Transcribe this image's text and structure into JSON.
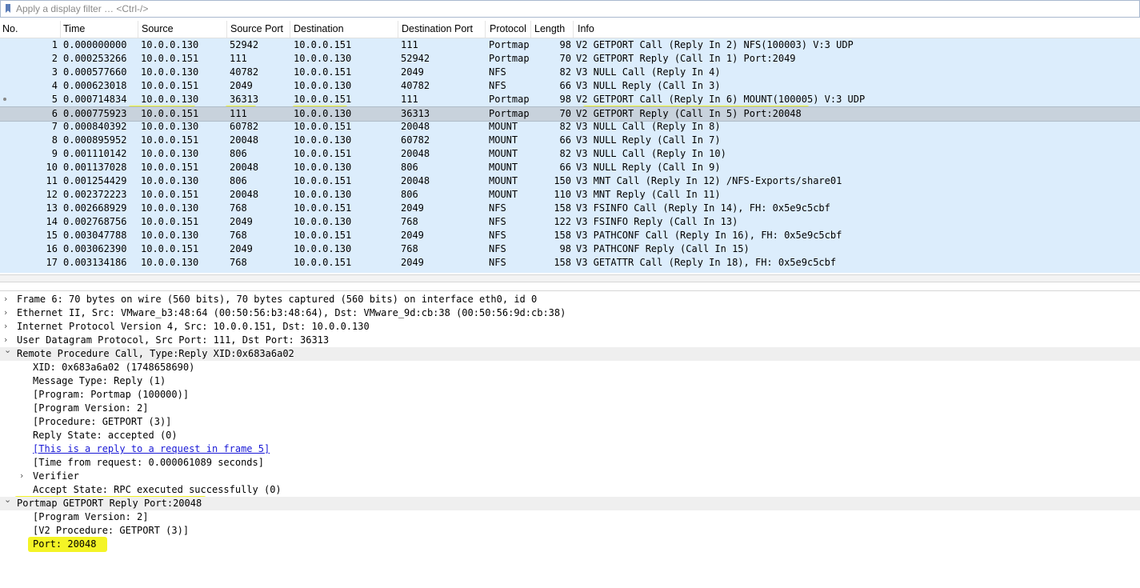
{
  "filter": {
    "placeholder": "Apply a display filter … <Ctrl-/>"
  },
  "columns": [
    "No.",
    "Time",
    "Source",
    "Source Port",
    "Destination",
    "Destination Port",
    "Protocol",
    "Length",
    "Info"
  ],
  "packets": [
    {
      "no": "1",
      "time": "0.000000000",
      "src": "10.0.0.130",
      "sport": "52942",
      "dst": "10.0.0.151",
      "dport": "111",
      "proto": "Portmap",
      "len": "98",
      "info": "V2 GETPORT Call (Reply In 2) NFS(100003) V:3 UDP"
    },
    {
      "no": "2",
      "time": "0.000253266",
      "src": "10.0.0.151",
      "sport": "111",
      "dst": "10.0.0.130",
      "dport": "52942",
      "proto": "Portmap",
      "len": "70",
      "info": "V2 GETPORT Reply (Call In 1) Port:2049"
    },
    {
      "no": "3",
      "time": "0.000577660",
      "src": "10.0.0.130",
      "sport": "40782",
      "dst": "10.0.0.151",
      "dport": "2049",
      "proto": "NFS",
      "len": "82",
      "info": "V3 NULL Call (Reply In 4)"
    },
    {
      "no": "4",
      "time": "0.000623018",
      "src": "10.0.0.151",
      "sport": "2049",
      "dst": "10.0.0.130",
      "dport": "40782",
      "proto": "NFS",
      "len": "66",
      "info": "V3 NULL Reply (Call In 3)"
    },
    {
      "no": "5",
      "time": "0.000714834",
      "src": "10.0.0.130",
      "sport": "36313",
      "dst": "10.0.0.151",
      "dport": "111",
      "proto": "Portmap",
      "len": "98",
      "info": "V2 GETPORT Call (Reply In 6) MOUNT(100005) V:3 UDP"
    },
    {
      "no": "6",
      "time": "0.000775923",
      "src": "10.0.0.151",
      "sport": "111",
      "dst": "10.0.0.130",
      "dport": "36313",
      "proto": "Portmap",
      "len": "70",
      "info": "V2 GETPORT Reply (Call In 5) Port:20048"
    },
    {
      "no": "7",
      "time": "0.000840392",
      "src": "10.0.0.130",
      "sport": "60782",
      "dst": "10.0.0.151",
      "dport": "20048",
      "proto": "MOUNT",
      "len": "82",
      "info": "V3 NULL Call (Reply In 8)"
    },
    {
      "no": "8",
      "time": "0.000895952",
      "src": "10.0.0.151",
      "sport": "20048",
      "dst": "10.0.0.130",
      "dport": "60782",
      "proto": "MOUNT",
      "len": "66",
      "info": "V3 NULL Reply (Call In 7)"
    },
    {
      "no": "9",
      "time": "0.001110142",
      "src": "10.0.0.130",
      "sport": "806",
      "dst": "10.0.0.151",
      "dport": "20048",
      "proto": "MOUNT",
      "len": "82",
      "info": "V3 NULL Call (Reply In 10)"
    },
    {
      "no": "10",
      "time": "0.001137028",
      "src": "10.0.0.151",
      "sport": "20048",
      "dst": "10.0.0.130",
      "dport": "806",
      "proto": "MOUNT",
      "len": "66",
      "info": "V3 NULL Reply (Call In 9)"
    },
    {
      "no": "11",
      "time": "0.001254429",
      "src": "10.0.0.130",
      "sport": "806",
      "dst": "10.0.0.151",
      "dport": "20048",
      "proto": "MOUNT",
      "len": "150",
      "info": "V3 MNT Call (Reply In 12) /NFS-Exports/share01"
    },
    {
      "no": "12",
      "time": "0.002372223",
      "src": "10.0.0.151",
      "sport": "20048",
      "dst": "10.0.0.130",
      "dport": "806",
      "proto": "MOUNT",
      "len": "110",
      "info": "V3 MNT Reply (Call In 11)"
    },
    {
      "no": "13",
      "time": "0.002668929",
      "src": "10.0.0.130",
      "sport": "768",
      "dst": "10.0.0.151",
      "dport": "2049",
      "proto": "NFS",
      "len": "158",
      "info": "V3 FSINFO Call (Reply In 14), FH: 0x5e9c5cbf"
    },
    {
      "no": "14",
      "time": "0.002768756",
      "src": "10.0.0.151",
      "sport": "2049",
      "dst": "10.0.0.130",
      "dport": "768",
      "proto": "NFS",
      "len": "122",
      "info": "V3 FSINFO Reply (Call In 13)"
    },
    {
      "no": "15",
      "time": "0.003047788",
      "src": "10.0.0.130",
      "sport": "768",
      "dst": "10.0.0.151",
      "dport": "2049",
      "proto": "NFS",
      "len": "158",
      "info": "V3 PATHCONF Call (Reply In 16), FH: 0x5e9c5cbf"
    },
    {
      "no": "16",
      "time": "0.003062390",
      "src": "10.0.0.151",
      "sport": "2049",
      "dst": "10.0.0.130",
      "dport": "768",
      "proto": "NFS",
      "len": "98",
      "info": "V3 PATHCONF Reply (Call In 15)"
    },
    {
      "no": "17",
      "time": "0.003134186",
      "src": "10.0.0.130",
      "sport": "768",
      "dst": "10.0.0.151",
      "dport": "2049",
      "proto": "NFS",
      "len": "158",
      "info": "V3 GETATTR Call (Reply In 18), FH: 0x5e9c5cbf"
    }
  ],
  "details": [
    {
      "text": "Frame 6: 70 bytes on wire (560 bits), 70 bytes captured (560 bits) on interface eth0, id 0",
      "indent": 0,
      "expander": "collapsed"
    },
    {
      "text": "Ethernet II, Src: VMware_b3:48:64 (00:50:56:b3:48:64), Dst: VMware_9d:cb:38 (00:50:56:9d:cb:38)",
      "indent": 0,
      "expander": "collapsed"
    },
    {
      "text": "Internet Protocol Version 4, Src: 10.0.0.151, Dst: 10.0.0.130",
      "indent": 0,
      "expander": "collapsed"
    },
    {
      "text": "User Datagram Protocol, Src Port: 111, Dst Port: 36313",
      "indent": 0,
      "expander": "collapsed"
    },
    {
      "text": "Remote Procedure Call, Type:Reply XID:0x683a6a02",
      "indent": 0,
      "expander": "expanded",
      "header": true
    },
    {
      "text": "XID: 0x683a6a02 (1748658690)",
      "indent": 1
    },
    {
      "text": "Message Type: Reply (1)",
      "indent": 1
    },
    {
      "text": "[Program: Portmap (100000)]",
      "indent": 1
    },
    {
      "text": "[Program Version: 2]",
      "indent": 1
    },
    {
      "text": "[Procedure: GETPORT (3)]",
      "indent": 1
    },
    {
      "text": "Reply State: accepted (0)",
      "indent": 1
    },
    {
      "text": "[This is a reply to a request in frame 5]",
      "indent": 1,
      "link": true
    },
    {
      "text": "[Time from request: 0.000061089 seconds]",
      "indent": 1
    },
    {
      "text": "Verifier",
      "indent": 1,
      "expander": "collapsed"
    },
    {
      "text": "Accept State: RPC executed successfully (0)",
      "indent": 1
    },
    {
      "text": "Portmap GETPORT Reply Port:20048",
      "indent": 0,
      "expander": "expanded",
      "header": true
    },
    {
      "text": "[Program Version: 2]",
      "indent": 1
    },
    {
      "text": "[V2 Procedure: GETPORT (3)]",
      "indent": 1
    },
    {
      "text": "Port: 20048",
      "indent": 1
    }
  ]
}
